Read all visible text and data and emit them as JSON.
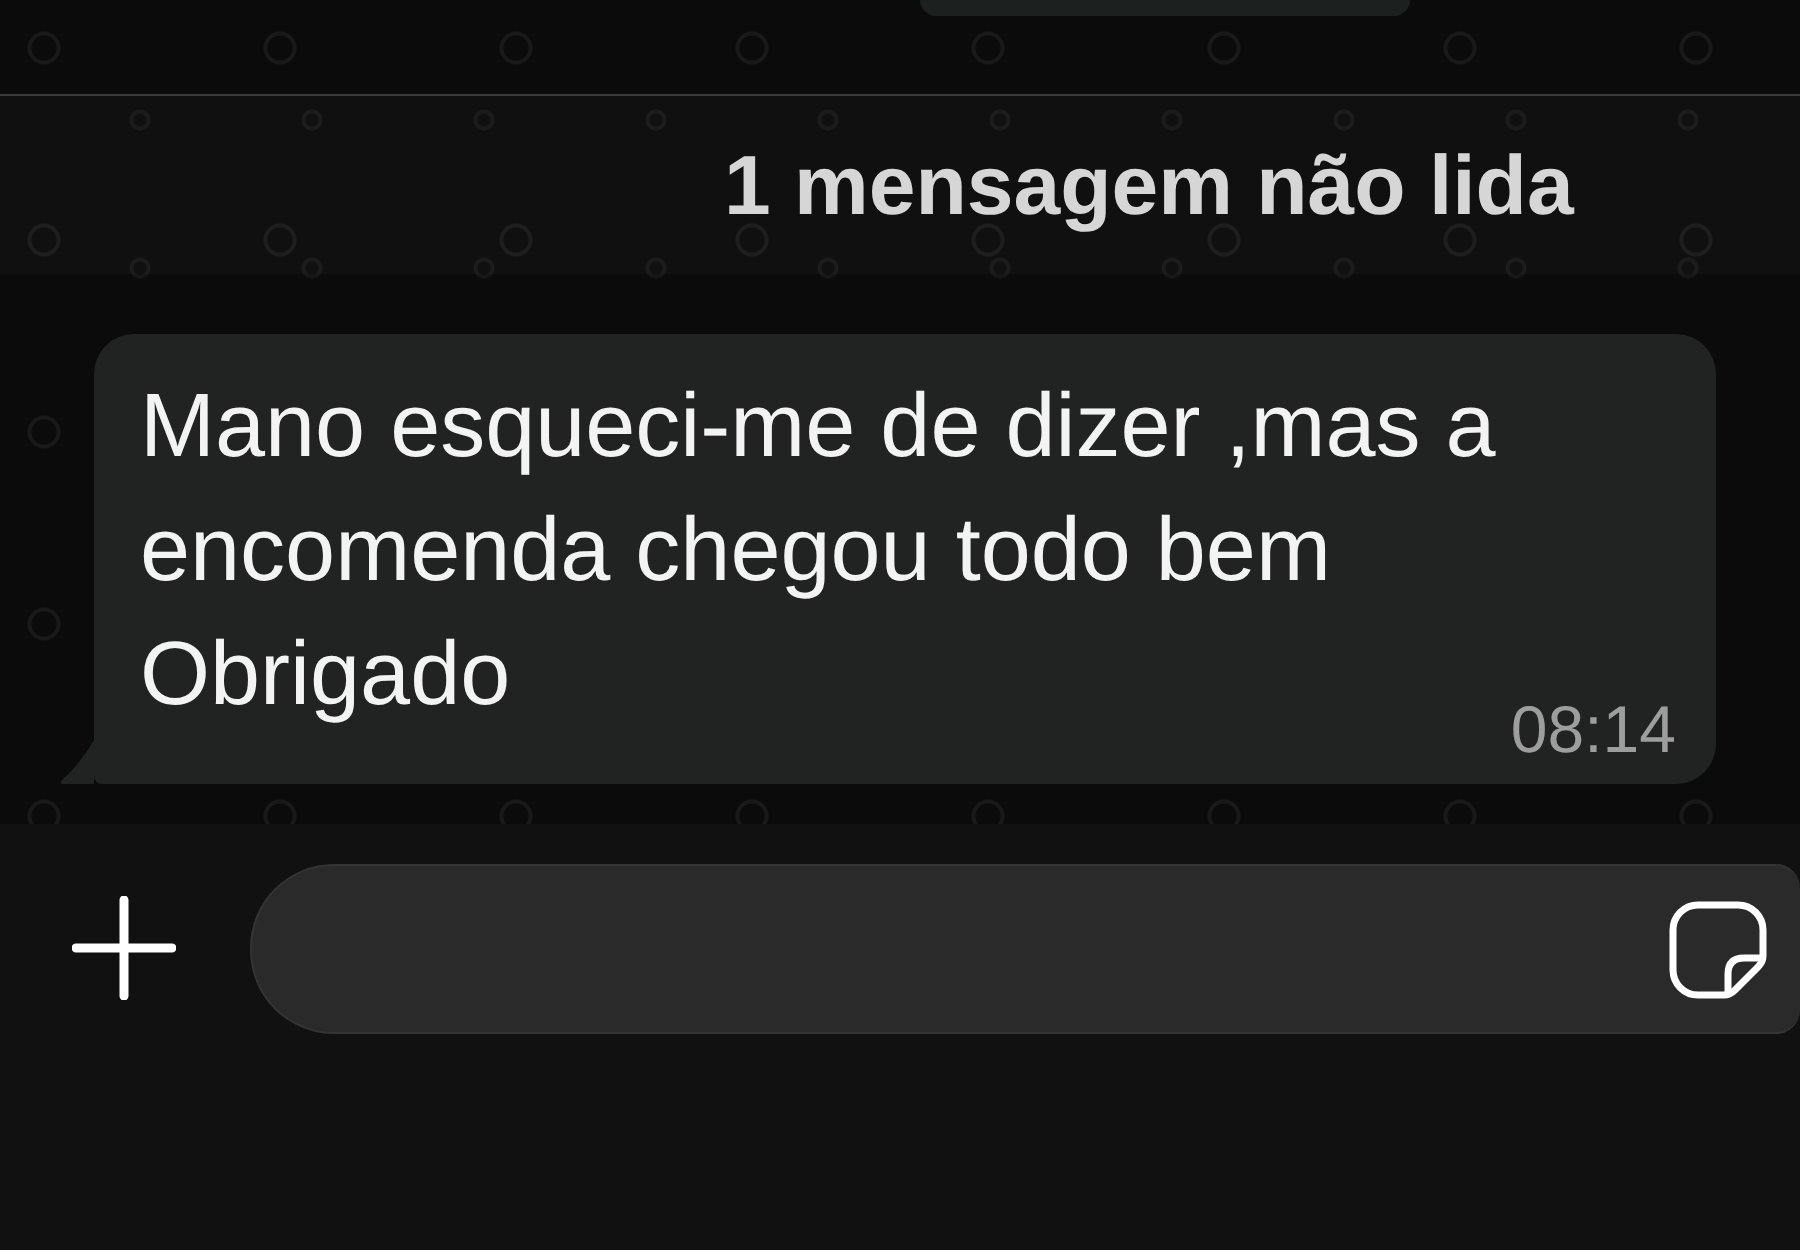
{
  "unread_banner": {
    "label": "1 mensagem não lida"
  },
  "messages": [
    {
      "kind": "incoming",
      "text": "Mano esqueci-me de dizer ,mas a encomenda chegou todo bem Obrigado",
      "time": "08:14"
    }
  ]
}
